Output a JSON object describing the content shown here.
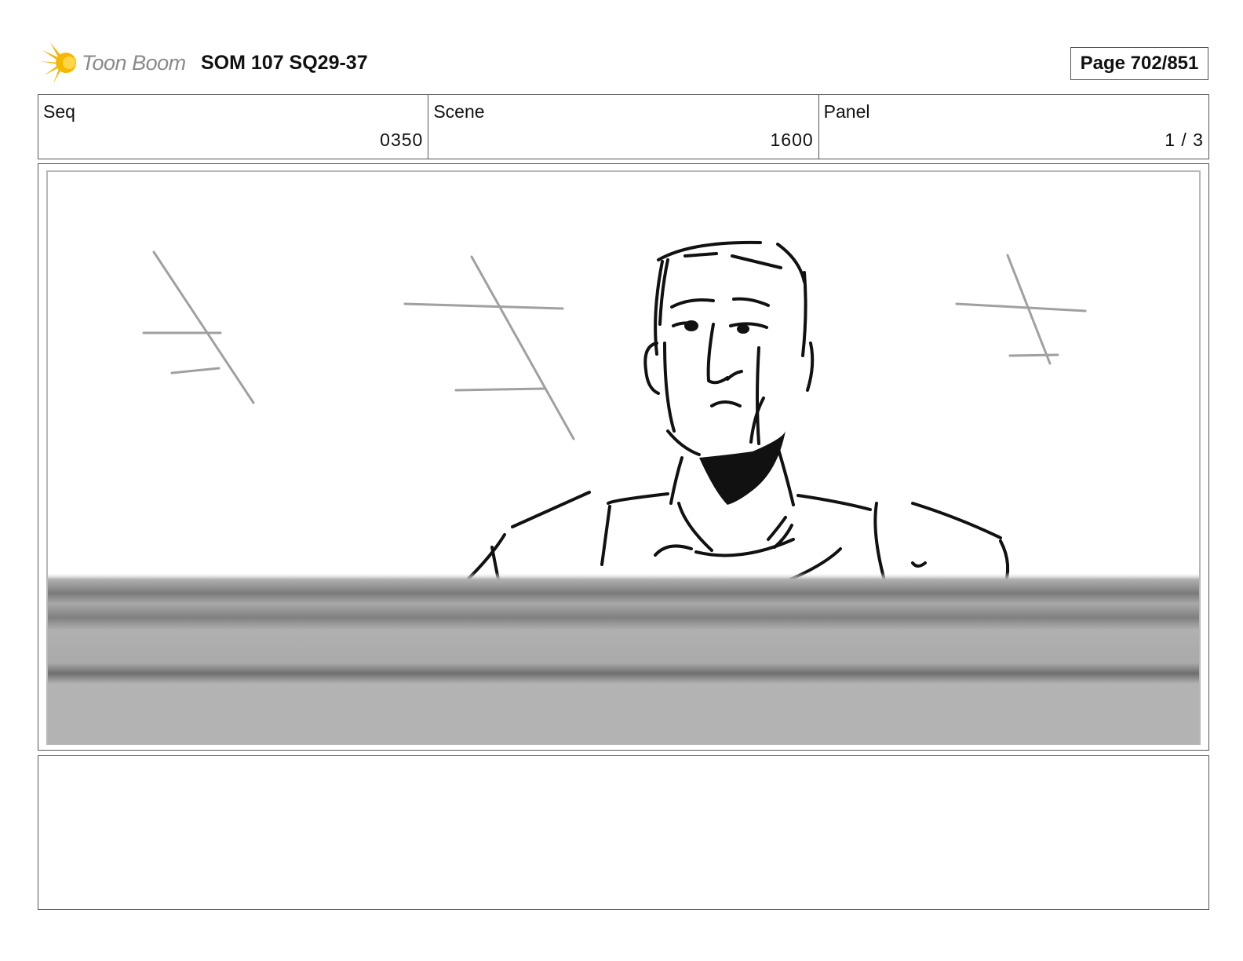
{
  "header": {
    "logo_text": "Toon Boom",
    "title": "SOM 107 SQ29-37",
    "page_label": "Page 702/851"
  },
  "info": {
    "seq_label": "Seq",
    "seq_value": "0350",
    "scene_label": "Scene",
    "scene_value": "1600",
    "panel_label": "Panel",
    "panel_value": "1 / 3"
  },
  "colors": {
    "logo_accent": "#F5B800",
    "sketch_line": "#111111",
    "guide_line": "#a0a0a0",
    "foreground_bar": "#b3b3b3"
  }
}
